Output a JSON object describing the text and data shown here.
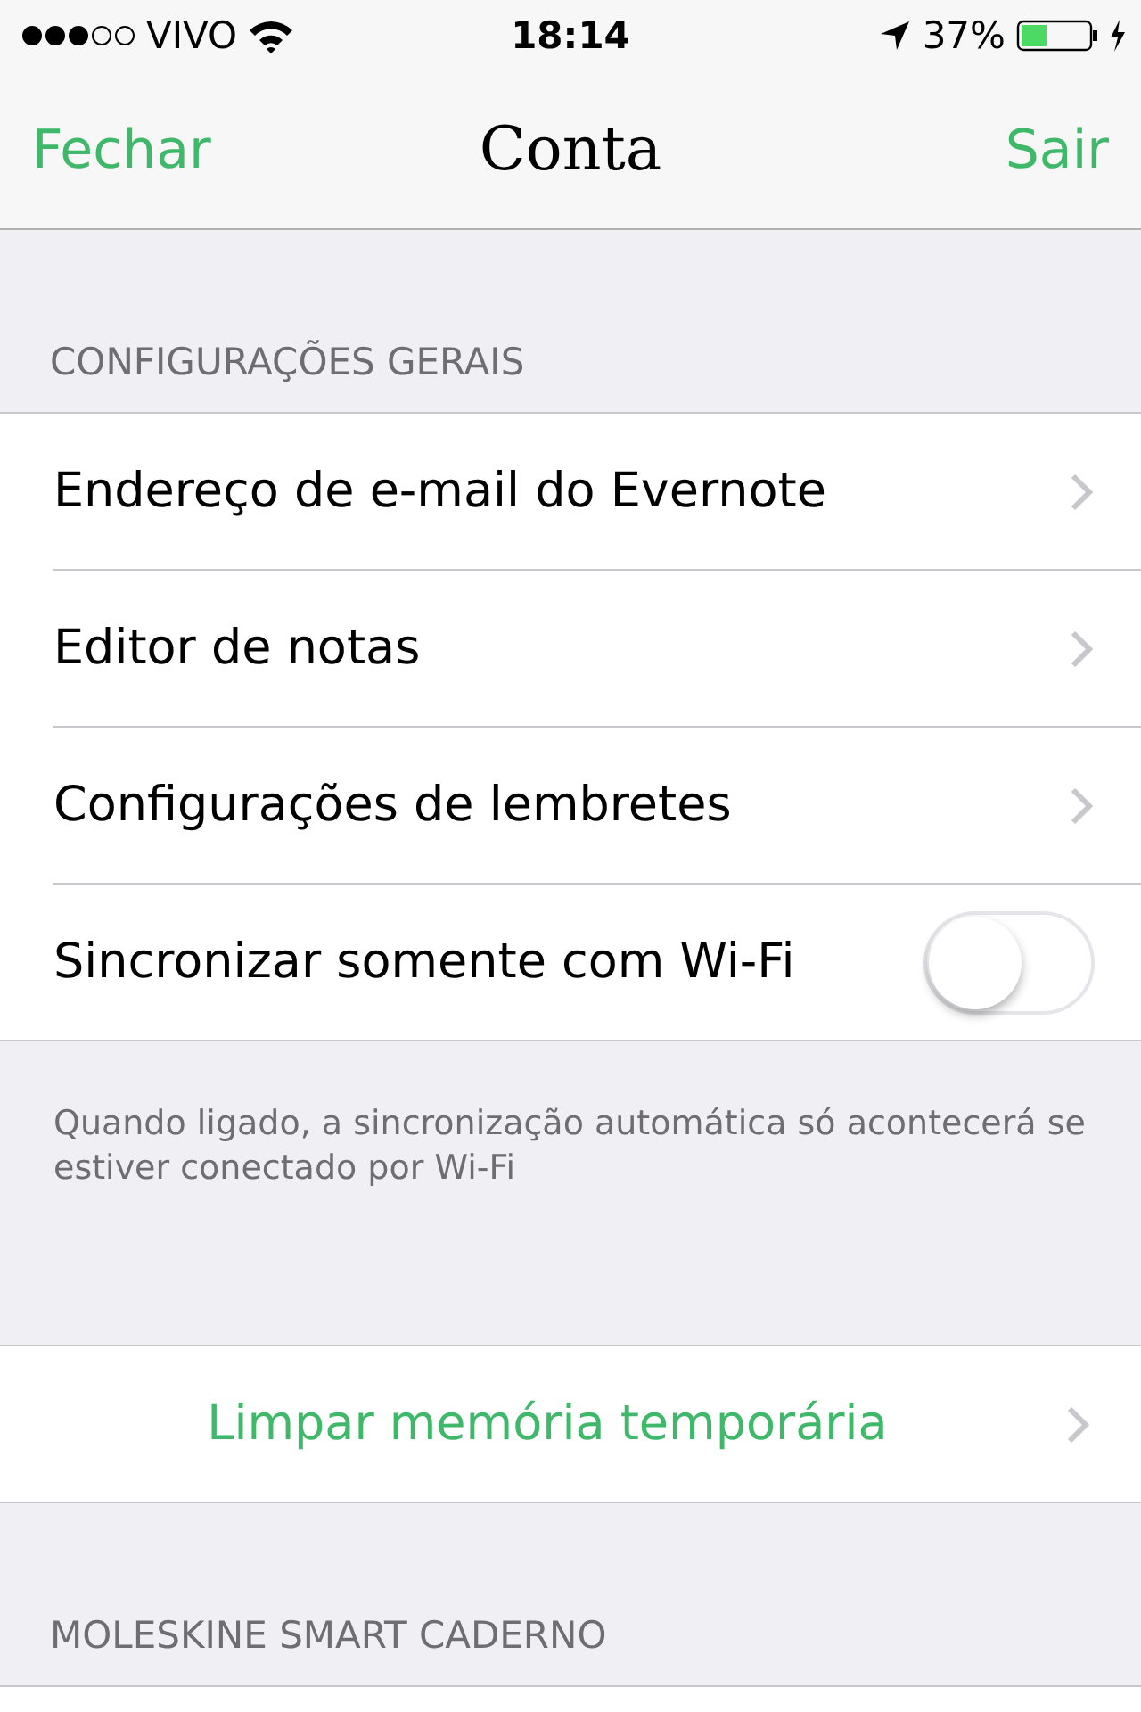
{
  "status_bar": {
    "carrier": "VIVO",
    "time": "18:14",
    "battery": "37%"
  },
  "nav": {
    "left": "Fechar",
    "title": "Conta",
    "right": "Sair"
  },
  "sections": [
    {
      "header": "CONFIGURAÇÕES GERAIS",
      "rows": [
        {
          "kind": "link",
          "label": "Endereço de e-mail do Evernote"
        },
        {
          "kind": "link",
          "label": "Editor de notas"
        },
        {
          "kind": "link",
          "label": "Configurações de lembretes"
        },
        {
          "kind": "toggle",
          "label": "Sincronizar somente com Wi-Fi",
          "on": false
        }
      ],
      "footer": "Quando ligado, a sincronização automática só acontecerá se estiver conectado por Wi-Fi"
    },
    {
      "rows": [
        {
          "kind": "action",
          "label": "Limpar memória temporária"
        }
      ]
    },
    {
      "header": "MOLESKINE SMART CADERNO",
      "rows": [
        {
          "kind": "cut"
        }
      ]
    }
  ]
}
